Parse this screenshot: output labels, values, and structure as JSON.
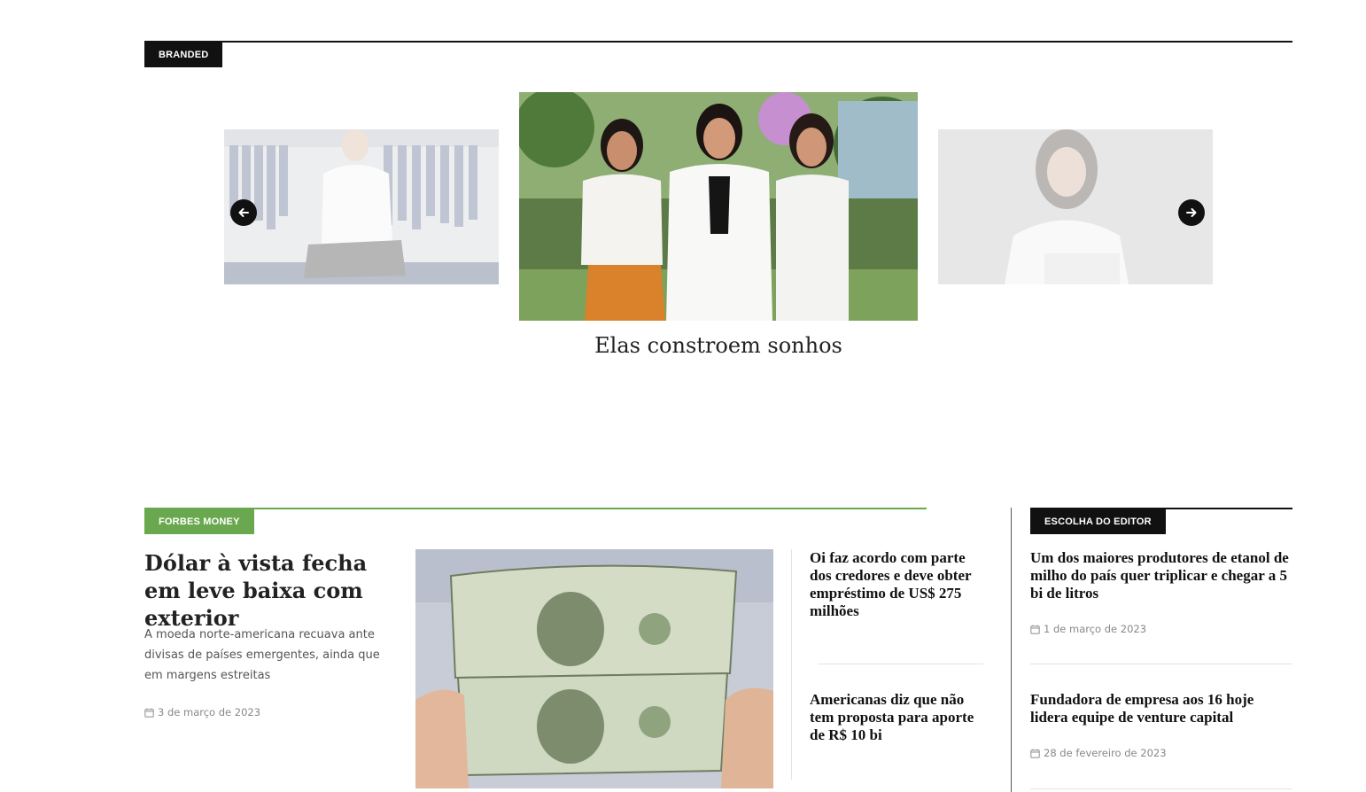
{
  "branded": {
    "tag": "BRANDED",
    "prev_icon": "arrow-left-icon",
    "next_icon": "arrow-right-icon",
    "slides": [
      {
        "alt": "man-in-clothing-store-photo"
      },
      {
        "alt": "three-women-outdoors-photo",
        "title": "Elas constroem sonhos"
      },
      {
        "alt": "woman-with-laptop-photo"
      }
    ]
  },
  "forbes_money": {
    "tag": "FORBES MONEY",
    "accent": "#6aa84f",
    "main": {
      "title": "Dólar à vista fecha em leve baixa com exterior",
      "excerpt": "A moeda norte-americana recuava ante divisas de países emergentes, ainda que em margens estreitas",
      "date": "3 de março de 2023",
      "image": "dollar-bills-photo"
    },
    "side": [
      {
        "title": "Oi faz acordo com parte dos credores e deve obter empréstimo de US$ 275 milhões"
      },
      {
        "title": "Americanas diz que não tem proposta para aporte de R$ 10 bi"
      }
    ]
  },
  "editor_choice": {
    "tag": "ESCOLHA DO EDITOR",
    "calendar_icon": "calendar-icon",
    "items": [
      {
        "title": "Um dos maiores produtores de etanol de milho do país quer triplicar e chegar a 5 bi de litros",
        "date": "1 de março de 2023"
      },
      {
        "title": "Fundadora de empresa aos 16 hoje lidera equipe de venture capital",
        "date": "28 de fevereiro de 2023"
      }
    ]
  }
}
